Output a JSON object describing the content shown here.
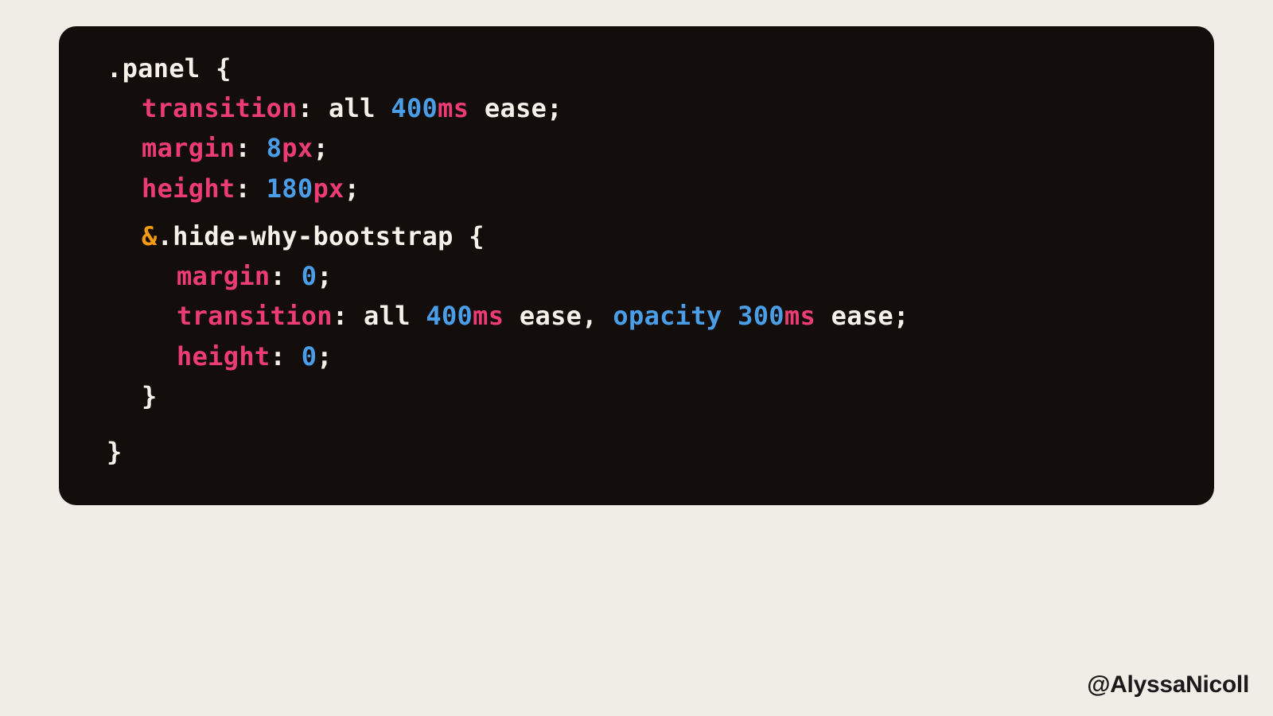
{
  "code": {
    "line1": {
      "selector": ".panel {"
    },
    "line2": {
      "prop": "transition",
      "sep1": ": all ",
      "num": "400",
      "unit": "ms",
      "sep2": " ease;"
    },
    "line3": {
      "prop": "margin",
      "sep1": ": ",
      "num": "8",
      "unit": "px",
      "sep2": ";"
    },
    "line4": {
      "prop": "height",
      "sep1": ": ",
      "num": "180",
      "unit": "px",
      "sep2": ";"
    },
    "line5": {
      "amp": "&",
      "selector": ".hide-why-bootstrap {"
    },
    "line6": {
      "prop": "margin",
      "sep1": ": ",
      "num": "0",
      "sep2": ";"
    },
    "line7": {
      "prop": "transition",
      "sep1": ": all ",
      "num1": "400",
      "unit1": "ms",
      "sep2": " ease, ",
      "ident": "opacity",
      "sp1": " ",
      "num2": "300",
      "unit2": "ms",
      "sep3": " ease;"
    },
    "line8": {
      "prop": "height",
      "sep1": ": ",
      "num": "0",
      "sep2": ";"
    },
    "line9": {
      "brace": "}"
    },
    "line10": {
      "brace": "}"
    }
  },
  "attribution": "@AlyssaNicoll"
}
